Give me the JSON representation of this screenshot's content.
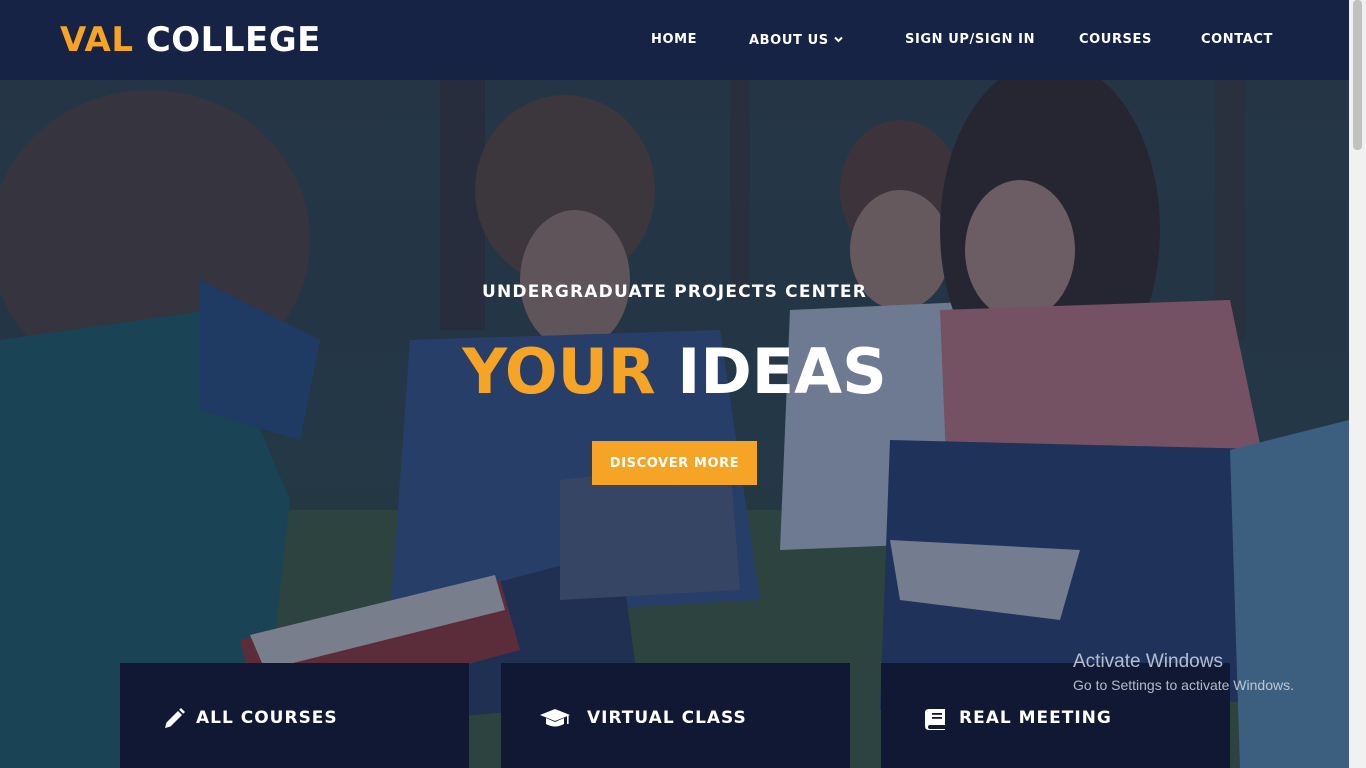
{
  "brand": {
    "part1": "VAL",
    "part2": "COLLEGE"
  },
  "nav": {
    "home": "HOME",
    "about": "ABOUT US",
    "signup": "SIGN UP/SIGN IN",
    "courses": "COURSES",
    "contact": "CONTACT"
  },
  "hero": {
    "kicker": "UNDERGRADUATE PROJECTS CENTER",
    "headline_accent": "YOUR",
    "headline_rest": "IDEAS",
    "cta": "DISCOVER MORE"
  },
  "features": [
    {
      "label": "ALL COURSES",
      "icon": "pencil-icon"
    },
    {
      "label": "VIRTUAL CLASS",
      "icon": "graduation-cap-icon"
    },
    {
      "label": "REAL MEETING",
      "icon": "book-icon"
    }
  ],
  "watermark": {
    "title": "Activate Windows",
    "subtitle": "Go to Settings to activate Windows."
  },
  "colors": {
    "accent": "#f5a425",
    "header_bg": "#162345",
    "card_bg": "#111833"
  }
}
